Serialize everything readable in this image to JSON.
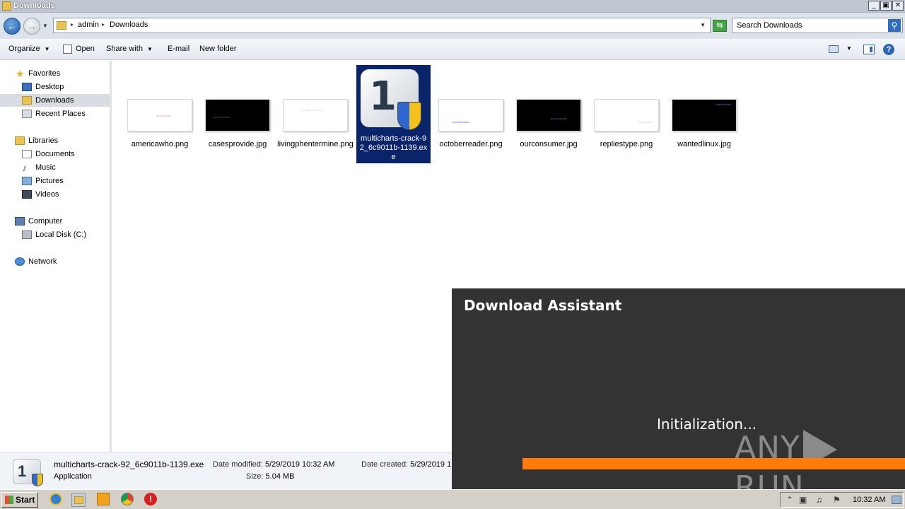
{
  "window": {
    "title": "Downloads"
  },
  "address": {
    "crumbs": [
      "admin",
      "Downloads"
    ],
    "search_placeholder": "Search Downloads"
  },
  "toolbar": {
    "organize": "Organize",
    "open": "Open",
    "share_with": "Share with",
    "email": "E-mail",
    "new_folder": "New folder"
  },
  "nav": {
    "favorites": "Favorites",
    "desktop": "Desktop",
    "downloads": "Downloads",
    "recent_places": "Recent Places",
    "libraries": "Libraries",
    "documents": "Documents",
    "music": "Music",
    "pictures": "Pictures",
    "videos": "Videos",
    "computer": "Computer",
    "local_disk": "Local Disk (C:)",
    "network": "Network"
  },
  "files": [
    {
      "name": "americawho.png",
      "thumb_text": "americawho",
      "thumb_bg": "#ffffff",
      "thumb_fg": "#e0a0c0"
    },
    {
      "name": "casesprovide.jpg",
      "thumb_text": "casesprovide",
      "thumb_bg": "#000000",
      "thumb_fg": "#555555"
    },
    {
      "name": "livingphentermine.png",
      "thumb_text": "livingphentermine",
      "thumb_bg": "#ffffff",
      "thumb_fg": "#dddddd"
    },
    {
      "name": "multicharts-crack-92_6c9011b-1139.exe",
      "selected": true
    },
    {
      "name": "octoberreader.png",
      "thumb_text": "octoberreader",
      "thumb_bg": "#ffffff",
      "thumb_fg": "#5a5ae0"
    },
    {
      "name": "ourconsumer.jpg",
      "thumb_text": "ourconsumer",
      "thumb_bg": "#000000",
      "thumb_fg": "#7a5a9a"
    },
    {
      "name": "repliestype.png",
      "thumb_text": "repliestype",
      "thumb_bg": "#ffffff",
      "thumb_fg": "#cccccc"
    },
    {
      "name": "wantedlinux.jpg",
      "thumb_text": "wantedlinux",
      "thumb_bg": "#000000",
      "thumb_fg": "#3a7ad0"
    }
  ],
  "details": {
    "filename": "multicharts-crack-92_6c9011b-1139.exe",
    "type": "Application",
    "date_modified_label": "Date modified:",
    "date_modified": "5/29/2019 10:32 AM",
    "size_label": "Size:",
    "size": "5.04 MB",
    "date_created_label": "Date created:",
    "date_created": "5/29/2019 1"
  },
  "assistant": {
    "title": "Download Assistant",
    "status": "Initialization...",
    "watermark_left": "ANY",
    "watermark_right": "RUN",
    "bar_color": "#ff7c0a"
  },
  "taskbar": {
    "start_label": "Start",
    "clock": "10:32 AM"
  }
}
